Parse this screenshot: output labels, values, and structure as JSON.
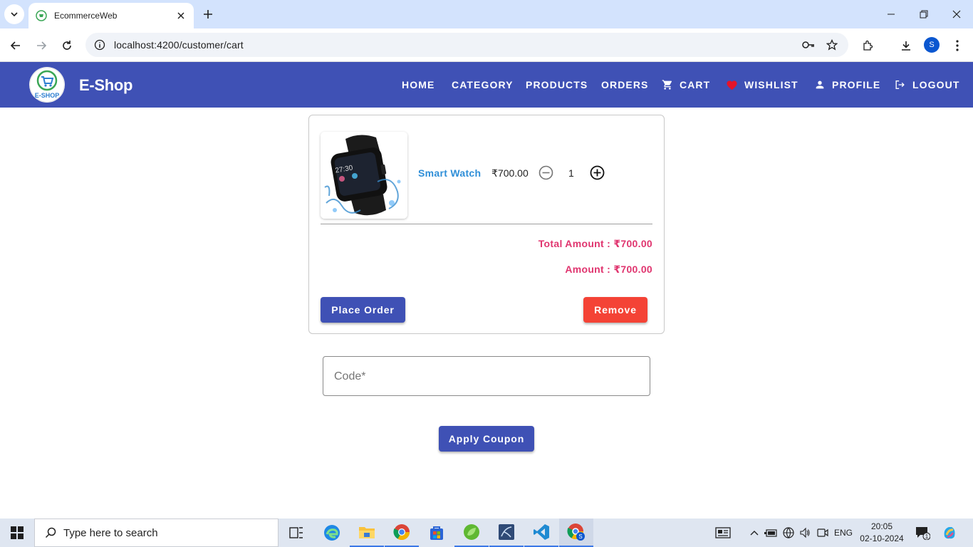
{
  "browser": {
    "tab_title": "EcommerceWeb",
    "url": "localhost:4200/customer/cart",
    "profile_initial": "S"
  },
  "navbar": {
    "brand": "E-Shop",
    "logo_text": "E-SHOP",
    "items": [
      {
        "label": "HOME",
        "icon": null
      },
      {
        "label": "CATEGORY",
        "icon": null
      },
      {
        "label": "PRODUCTS",
        "icon": null
      },
      {
        "label": "ORDERS",
        "icon": null
      },
      {
        "label": "CART",
        "icon": "shopping-cart-icon"
      },
      {
        "label": "WISHLIST",
        "icon": "heart-icon"
      },
      {
        "label": "PROFILE",
        "icon": "person-icon"
      },
      {
        "label": "LOGOUT",
        "icon": "logout-icon"
      }
    ]
  },
  "cart": {
    "item": {
      "name": "Smart Watch",
      "price": "₹700.00",
      "quantity": "1"
    },
    "total_amount": "Total Amount : ₹700.00",
    "amount": "Amount : ₹700.00",
    "place_order_label": "Place Order",
    "remove_label": "Remove"
  },
  "coupon": {
    "placeholder": "Code*",
    "apply_label": "Apply Coupon"
  },
  "taskbar": {
    "search_placeholder": "Type here to search",
    "language": "ENG",
    "time": "20:05",
    "date": "02-10-2024",
    "notification_count": "1"
  },
  "colors": {
    "primary": "#3f51b5",
    "warn": "#f44336",
    "accent_pink": "#e0356f",
    "link_blue": "#2f8fd8"
  }
}
